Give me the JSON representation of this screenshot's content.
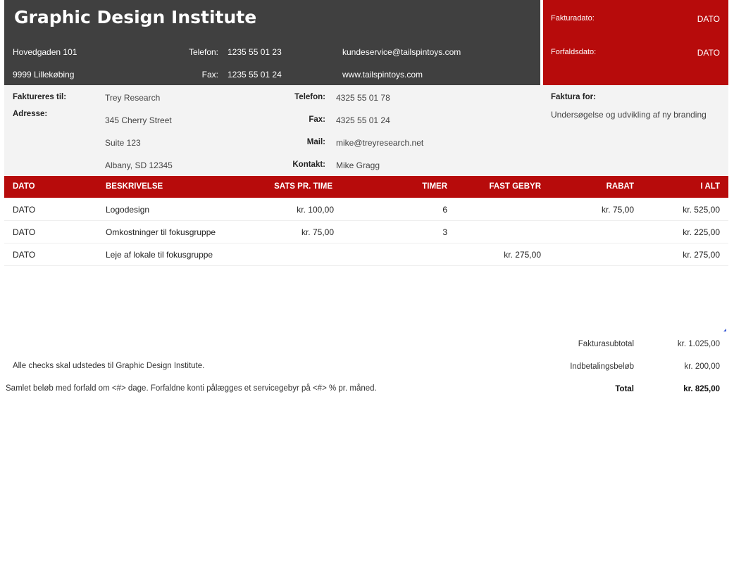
{
  "company": {
    "name": "Graphic Design Institute",
    "address1": "Hovedgaden 101",
    "address2": "9999 Lillekøbing",
    "phone_label": "Telefon:",
    "phone": "1235 55 01 23",
    "fax_label": "Fax:",
    "fax": "1235 55 01 24",
    "email": "kundeservice@tailspintoys.com",
    "web": "www.tailspintoys.com"
  },
  "invoice_meta": {
    "invoice_date_label": "Fakturadato:",
    "invoice_date": "DATO",
    "due_date_label": "Forfaldsdato:",
    "due_date": "DATO"
  },
  "bill_to": {
    "label": "Faktureres til:",
    "address_label": "Adresse:",
    "name": "Trey Research",
    "street": "345 Cherry Street",
    "suite": "Suite 123",
    "city": "Albany, SD 12345",
    "phone_label": "Telefon:",
    "phone": "4325 55 01 78",
    "fax_label": "Fax:",
    "fax": "4325 55 01 24",
    "mail_label": "Mail:",
    "mail": "mike@treyresearch.net",
    "contact_label": "Kontakt:",
    "contact": "Mike Gragg",
    "invoice_for_label": "Faktura for:",
    "invoice_for": "Undersøgelse og udvikling af ny branding"
  },
  "table": {
    "headers": [
      "DATO",
      "BESKRIVELSE",
      "SATS PR. TIME",
      "TIMER",
      "FAST GEBYR",
      "RABAT",
      "I ALT"
    ],
    "rows": [
      [
        "DATO",
        "Logodesign",
        "kr. 100,00",
        "6",
        "",
        "kr. 75,00",
        "kr. 525,00"
      ],
      [
        "DATO",
        "Omkostninger til fokusgruppe",
        "kr. 75,00",
        "3",
        "",
        "",
        "kr. 225,00"
      ],
      [
        "DATO",
        "Leje af lokale til fokusgruppe",
        "",
        "",
        "kr. 275,00",
        "",
        "kr. 275,00"
      ]
    ]
  },
  "totals": {
    "subtotal_label": "Fakturasubtotal",
    "subtotal": "kr. 1.025,00",
    "deposit_label": "Indbetalingsbeløb",
    "deposit": "kr. 200,00",
    "total_label": "Total",
    "total": "kr. 825,00"
  },
  "notes": {
    "checks": "Alle checks skal udstedes til Graphic Design Institute.",
    "terms": "Samlet beløb med forfald om <#> dage. Forfaldne konti pålægges et servicegebyr på <#> % pr. måned."
  },
  "colors": {
    "dark": "#404040",
    "red": "#b70b0b",
    "band": "#f3f3f3"
  }
}
